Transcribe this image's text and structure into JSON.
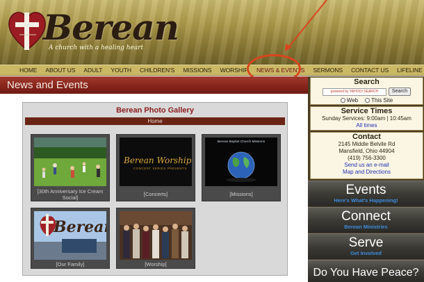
{
  "logo": {
    "title": "Berean",
    "tagline": "A church with a healing heart"
  },
  "nav": {
    "items": [
      {
        "label": "HOME"
      },
      {
        "label": "ABOUT US"
      },
      {
        "label": "ADULT"
      },
      {
        "label": "YOUTH"
      },
      {
        "label": "CHILDREN'S"
      },
      {
        "label": "MISSIONS"
      },
      {
        "label": "WORSHIP"
      },
      {
        "label": "NEWS & EVENTS"
      },
      {
        "label": "SERMONS"
      },
      {
        "label": "CONTACT US"
      },
      {
        "label": "LIFELINE"
      }
    ]
  },
  "page": {
    "title": "News and Events"
  },
  "gallery": {
    "title": "Berean Photo Gallery",
    "breadcrumb": "Home",
    "items": [
      {
        "caption": "[30th Anniversary Ice Cream Social]"
      },
      {
        "caption": "[Concerts]",
        "image_text": "Berean Worship",
        "image_subtext": "CONCERT SERIES PRESENTS"
      },
      {
        "caption": "[Missions]",
        "image_text": "Berean Baptist Church Missions"
      },
      {
        "caption": "[Our Family]",
        "image_text": "Berean"
      },
      {
        "caption": "[Worship]"
      }
    ]
  },
  "sidebar": {
    "search": {
      "heading": "Search",
      "input_placeholder": "powered by YAHOO! SEARCH",
      "button": "Search",
      "option_web": "Web",
      "option_site": "This Site"
    },
    "service_times": {
      "heading": "Service Times",
      "line": "Sunday Services: 9:00am | 10:45am",
      "link": "All times"
    },
    "contact": {
      "heading": "Contact",
      "address1": "2145 Middle Belvile Rd",
      "address2": "Mansfield, Ohio 44904",
      "phone": "(419) 756-3300",
      "email_link": "Send us an e-mail",
      "map_link": "Map and Directions"
    },
    "promos": [
      {
        "title": "Events",
        "subtitle": "Here's What's Happening!"
      },
      {
        "title": "Connect",
        "subtitle": "Berean Ministries"
      },
      {
        "title": "Serve",
        "subtitle": "Get Involved"
      },
      {
        "title": "Do You Have Peace?"
      }
    ]
  },
  "colors": {
    "accent_red": "#842319",
    "annotation": "#d9451e",
    "link_blue": "#1f2fb5",
    "promo_sub_blue": "#3d8de0"
  }
}
